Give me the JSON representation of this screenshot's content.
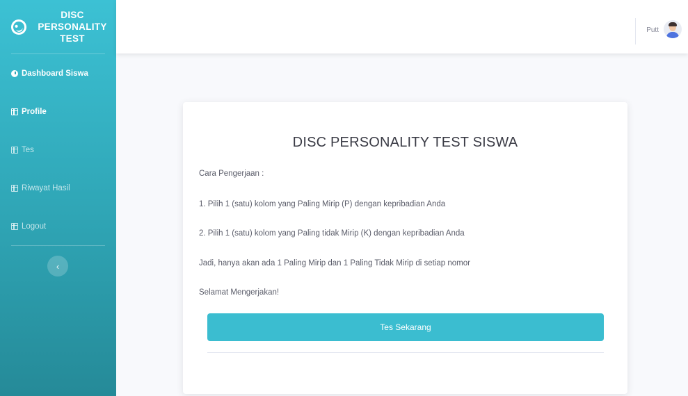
{
  "brand": {
    "title_lines": [
      "DISC",
      "PERSONALITY",
      "TEST"
    ],
    "logo_icon": "smile-wink-icon"
  },
  "sidebar": {
    "items": [
      {
        "label": "Dashboard Siswa",
        "icon": "gauge-icon"
      },
      {
        "label": "Profile",
        "icon": "table-icon"
      },
      {
        "label": "Tes",
        "icon": "table-icon"
      },
      {
        "label": "Riwayat Hasil",
        "icon": "table-icon"
      },
      {
        "label": "Logout",
        "icon": "table-icon"
      }
    ],
    "toggle_glyph": "‹"
  },
  "topbar": {
    "user_name": "Putt"
  },
  "card": {
    "title": "DISC PERSONALITY TEST SISWA",
    "intro": "Cara Pengerjaan :",
    "step1": "1. Pilih 1 (satu) kolom yang Paling Mirip (P) dengan kepribadian Anda",
    "step2": "2. Pilih 1 (satu) kolom yang Paling tidak Mirip (K) dengan kepribadian Anda",
    "note": "Jadi, hanya akan ada 1 Paling Mirip dan 1 Paling Tidak Mirip di setiap nomor",
    "closing": "Selamat Mengerjakan!",
    "button_label": "Tes Sekarang"
  },
  "colors": {
    "sidebar_top": "#3cc1d4",
    "sidebar_bottom": "#258a98",
    "button": "#3bbdd0"
  }
}
